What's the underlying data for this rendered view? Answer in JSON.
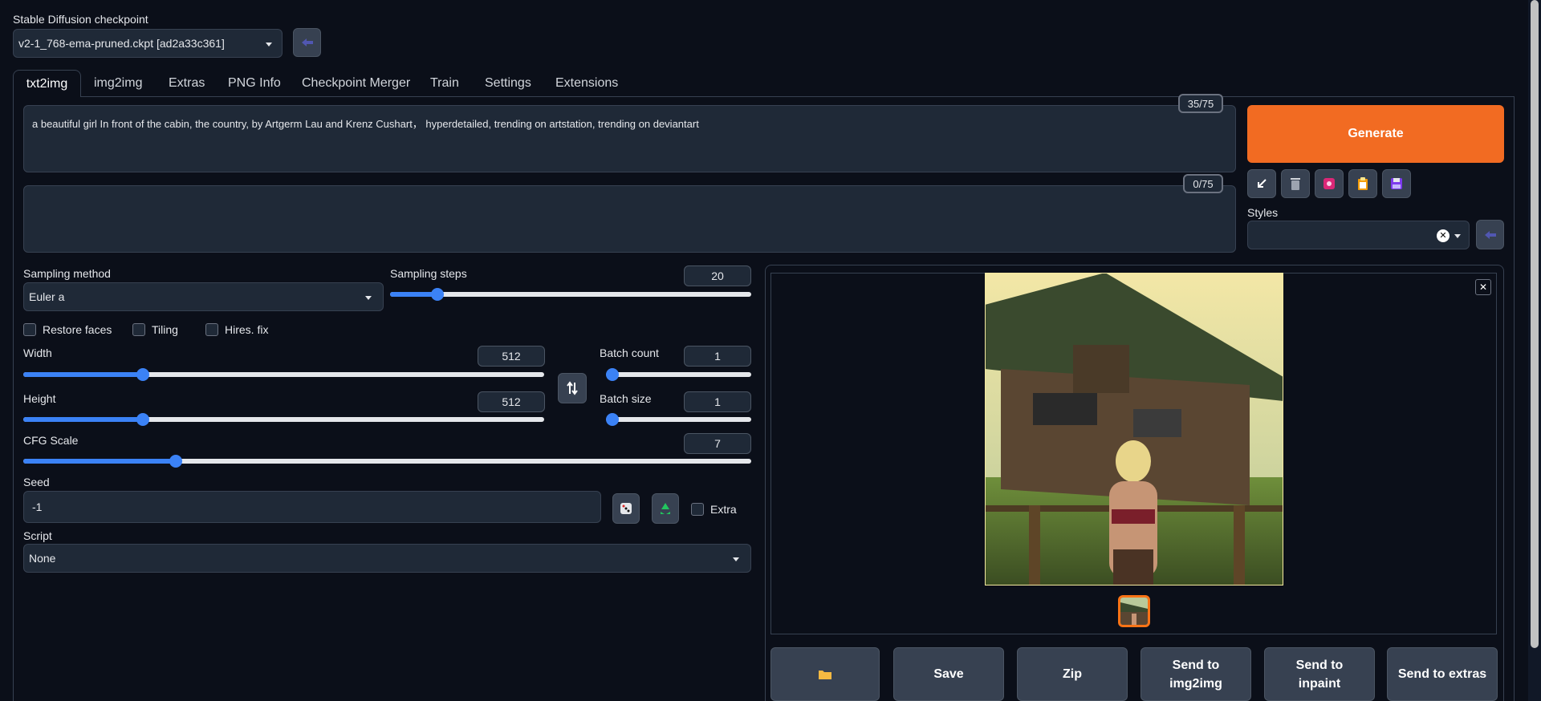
{
  "checkpoint": {
    "label": "Stable Diffusion checkpoint",
    "value": "v2-1_768-ema-pruned.ckpt [ad2a33c361]"
  },
  "tabs": [
    "txt2img",
    "img2img",
    "Extras",
    "PNG Info",
    "Checkpoint Merger",
    "Train",
    "Settings",
    "Extensions"
  ],
  "prompt": {
    "text": "a beautiful girl In front of the cabin, the country, by Artgerm Lau and Krenz Cushart，  hyperdetailed, trending on artstation, trending on deviantart",
    "token_count": "35/75"
  },
  "negative_prompt": {
    "text": "",
    "token_count": "0/75"
  },
  "generate": {
    "label": "Generate"
  },
  "styles": {
    "label": "Styles",
    "value": ""
  },
  "sampling_method": {
    "label": "Sampling method",
    "value": "Euler a"
  },
  "sampling_steps": {
    "label": "Sampling steps",
    "value": "20",
    "fraction": 0.13
  },
  "checkboxes": {
    "restore_faces": "Restore faces",
    "tiling": "Tiling",
    "hires_fix": "Hires. fix"
  },
  "width": {
    "label": "Width",
    "value": "512",
    "fraction": 0.23
  },
  "height": {
    "label": "Height",
    "value": "512",
    "fraction": 0.23
  },
  "batch_count": {
    "label": "Batch count",
    "value": "1",
    "fraction": 0.0
  },
  "batch_size": {
    "label": "Batch size",
    "value": "1",
    "fraction": 0.0
  },
  "cfg_scale": {
    "label": "CFG Scale",
    "value": "7",
    "fraction": 0.21
  },
  "seed": {
    "label": "Seed",
    "value": "-1",
    "extra_label": "Extra"
  },
  "script": {
    "label": "Script",
    "value": "None"
  },
  "output_actions": {
    "save": "Save",
    "zip": "Zip",
    "send_img2img": "Send to img2img",
    "send_inpaint": "Send to inpaint",
    "send_extras": "Send to extras"
  },
  "colors": {
    "accent": "#3b82f6",
    "generate": "#f26b22",
    "background": "#0b0f19"
  }
}
